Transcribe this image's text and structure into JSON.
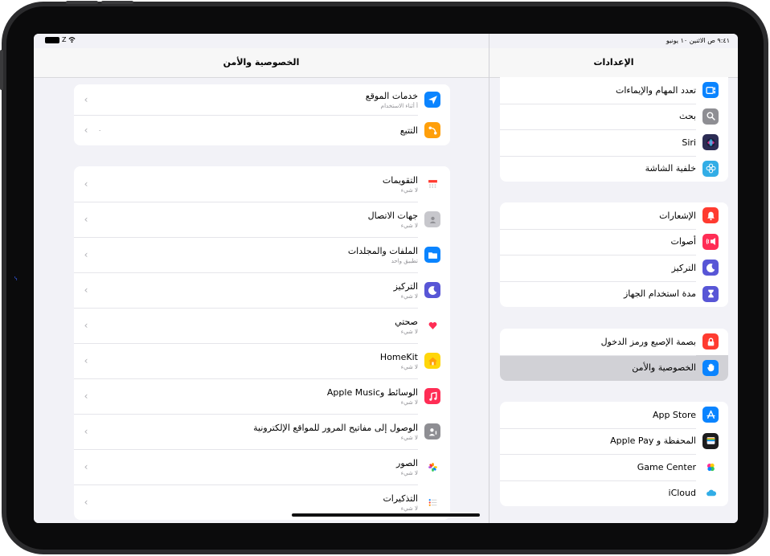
{
  "status": {
    "time": "٩:٤١ ص",
    "date": "الاثنين ١٠ يونيو",
    "battery_label": "Z"
  },
  "left_panel": {
    "title": "الخصوصية والأمن",
    "groups": [
      [
        {
          "title": "خدمات الموقع",
          "subtitle": "أ أثناء الاستخدام",
          "icon": "location-arrow-icon",
          "color": "#0a84ff"
        },
        {
          "title": "التتبع",
          "detail": "٠",
          "icon": "tracking-icon",
          "color": "#ff9f0a"
        }
      ],
      [
        {
          "title": "التقويمات",
          "subtitle": "لا شيء",
          "icon": "calendar-icon",
          "color": "#ffffff"
        },
        {
          "title": "جهات الاتصال",
          "subtitle": "لا شيء",
          "icon": "contacts-icon",
          "color": "#c7c7cc"
        },
        {
          "title": "الملفات والمجلدات",
          "subtitle": "تطبيق واحد",
          "icon": "folder-icon",
          "color": "#0a84ff"
        },
        {
          "title": "التركيز",
          "subtitle": "لا شيء",
          "icon": "moon-icon",
          "color": "#5856d6"
        },
        {
          "title": "صحتي",
          "subtitle": "لا شيء",
          "icon": "heart-icon",
          "color": "#ffffff"
        },
        {
          "title": "HomeKit",
          "subtitle": "لا شيء",
          "icon": "home-icon",
          "color": "#ffd60a"
        },
        {
          "title": "الوسائط وApple Music",
          "subtitle": "لا شيء",
          "icon": "music-note-icon",
          "color": "#ff2d55"
        },
        {
          "title": "الوصول إلى مفاتيح المرور للمواقع الإلكترونية",
          "subtitle": "لا شيء",
          "icon": "passkey-icon",
          "color": "#8e8e93"
        },
        {
          "title": "الصور",
          "subtitle": "لا شيء",
          "icon": "photos-flower-icon",
          "color": "#ffffff"
        },
        {
          "title": "التذكيرات",
          "subtitle": "لا شيء",
          "icon": "reminders-icon",
          "color": "#ffffff"
        }
      ]
    ]
  },
  "right_panel": {
    "title": "الإعدادات",
    "groups": [
      [
        {
          "title": "تعدد المهام والإيماءات",
          "icon": "multitasking-icon",
          "color": "#0a84ff"
        },
        {
          "title": "بحث",
          "icon": "search-icon",
          "color": "#8e8e93"
        },
        {
          "title": "Siri",
          "icon": "siri-icon",
          "color": "#2c2c54"
        },
        {
          "title": "خلفية الشاشة",
          "icon": "wallpaper-flower-icon",
          "color": "#32ade6"
        }
      ],
      [
        {
          "title": "الإشعارات",
          "icon": "bell-icon",
          "color": "#ff3b30"
        },
        {
          "title": "أصوات",
          "icon": "speaker-icon",
          "color": "#ff2d55"
        },
        {
          "title": "التركيز",
          "icon": "moon-icon",
          "color": "#5856d6"
        },
        {
          "title": "مدة استخدام الجهاز",
          "icon": "hourglass-icon",
          "color": "#5856d6"
        }
      ],
      [
        {
          "title": "بصمة الإصبع ورمز الدخول",
          "icon": "lock-icon",
          "color": "#ff3b30"
        },
        {
          "title": "الخصوصية والأمن",
          "icon": "hand-icon",
          "color": "#0a84ff",
          "selected": true
        }
      ],
      [
        {
          "title": "App Store",
          "icon": "app-store-icon",
          "color": "#0a84ff"
        },
        {
          "title": "المحفظة و Apple Pay",
          "icon": "wallet-icon",
          "color": "#1c1c1e"
        },
        {
          "title": "Game Center",
          "icon": "game-center-icon",
          "color": "#ffffff"
        },
        {
          "title": "iCloud",
          "icon": "cloud-icon",
          "color": "#ffffff"
        }
      ]
    ]
  }
}
